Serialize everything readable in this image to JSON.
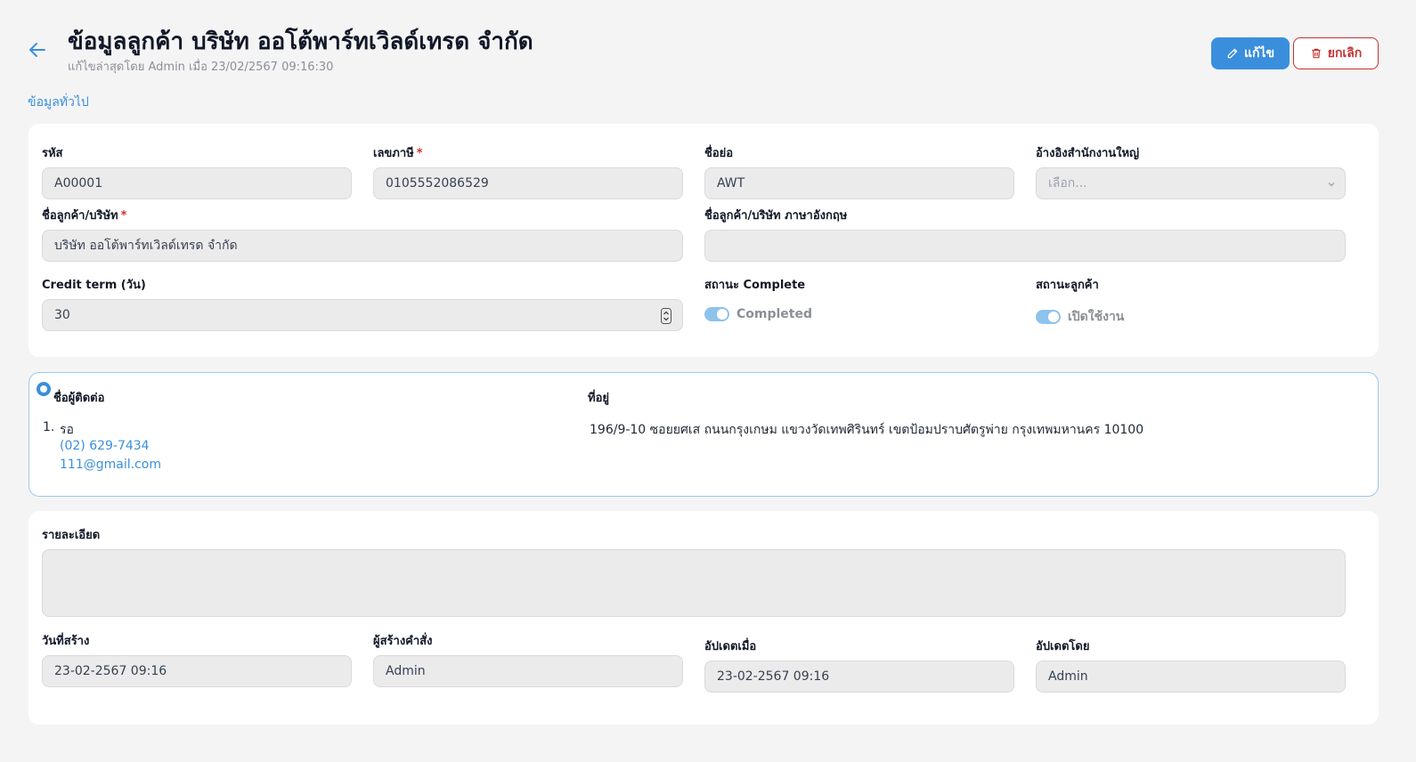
{
  "header": {
    "title": "ข้อมูลลูกค้า บริษัท ออโต้พาร์ทเวิลด์เทรด จำกัด",
    "subtitle": "แก้ไขล่าสุดโดย Admin เมื่อ 23/02/2567 09:16:30",
    "edit_label": "แก้ไข",
    "cancel_label": "ยกเลิก"
  },
  "section_link": "ข้อมูลทั่วไป",
  "general": {
    "code_label": "รหัส",
    "code_value": "A00001",
    "tax_label": "เลขภาษี",
    "tax_value": "0105552086529",
    "short_label": "ชื่อย่อ",
    "short_value": "AWT",
    "hq_label": "อ้างอิงสำนักงานใหญ่",
    "hq_placeholder": "เลือก...",
    "name_label": "ชื่อลูกค้า/บริษัท",
    "name_value": "บริษัท ออโต้พาร์ทเวิลด์เทรด จำกัด",
    "name_en_label": "ชื่อลูกค้า/บริษัท ภาษาอังกฤษ",
    "name_en_value": "",
    "credit_label": "Credit term (วัน)",
    "credit_value": "30",
    "complete_label": "สถานะ Complete",
    "complete_text": "Completed",
    "status_label": "สถานะลูกค้า",
    "status_text": "เปิดใช้งาน",
    "required_mark": "*"
  },
  "contact": {
    "name_header": "ชื่อผู้ติดต่อ",
    "address_header": "ที่อยู่",
    "index": "1.",
    "name": "รอ",
    "phone": "(02) 629-7434",
    "email": "111@gmail.com",
    "address": "196/9-10 ซอยยศเส ถนนกรุงเกษม แขวงวัดเทพศิรินทร์ เขตป้อมปราบศัตรูพ่าย กรุงเทพมหานคร 10100"
  },
  "detail": {
    "detail_label": "รายละเอียด",
    "created_label": "วันที่สร้าง",
    "created_value": "23-02-2567 09:16",
    "creator_label": "ผู้สร้างคำสั่ง",
    "creator_value": "Admin",
    "updated_label": "อัปเดตเมื่อ",
    "updated_value": "23-02-2567 09:16",
    "updater_label": "อัปเดตโดย",
    "updater_value": "Admin"
  },
  "colors": {
    "accent": "#3a8fdc",
    "danger": "#c53030",
    "background": "#f4f4f5"
  }
}
